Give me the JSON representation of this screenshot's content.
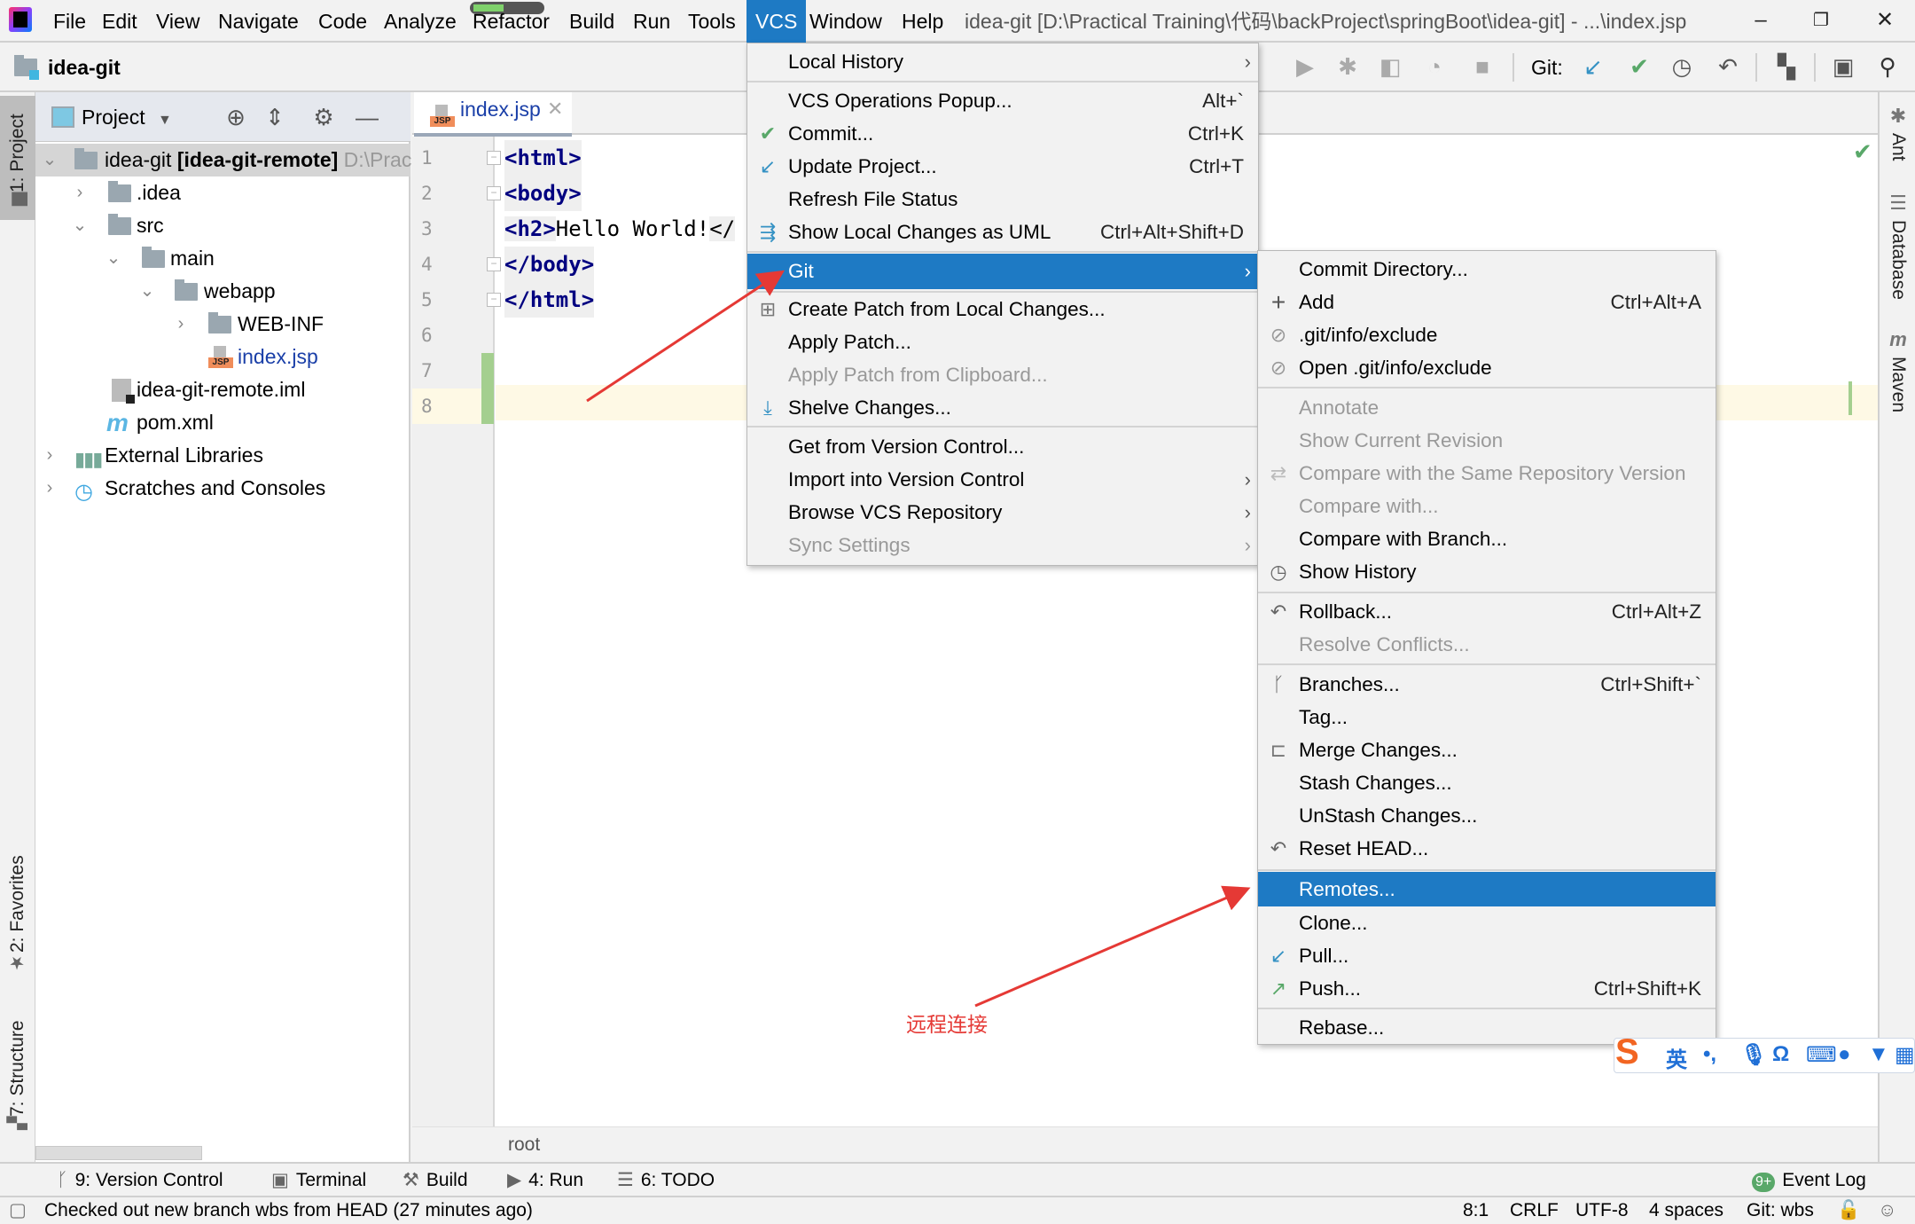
{
  "menubar": {
    "items": [
      "File",
      "Edit",
      "View",
      "Navigate",
      "Code",
      "Analyze",
      "Refactor",
      "Build",
      "Run",
      "Tools",
      "VCS",
      "Window",
      "Help"
    ],
    "active": "VCS",
    "window_title": "idea-git [D:\\Practical Training\\代码\\backProject\\springBoot\\idea-git] - ...\\index.jsp",
    "progress": 0.45,
    "controls": {
      "minimize": "–",
      "restore": "❐",
      "close": "✕"
    }
  },
  "navbar": {
    "project_name": "idea-git",
    "git_label": "Git:"
  },
  "left_stripe": {
    "tabs": [
      {
        "label": "1: Project",
        "icon": "folder-icon"
      },
      {
        "label": "2: Favorites",
        "icon": "star-icon"
      },
      {
        "label": "7: Structure",
        "icon": "structure-icon"
      }
    ]
  },
  "right_stripe": {
    "tabs": [
      {
        "label": "Ant",
        "icon": "ant-icon"
      },
      {
        "label": "Database",
        "icon": "database-icon"
      },
      {
        "label": "Maven",
        "icon": "maven-icon"
      }
    ]
  },
  "project_panel": {
    "title": "Project",
    "tree": [
      {
        "label": "idea-git",
        "bold_suffix": " [idea-git-remote]",
        "path_hint": " D:\\Prac",
        "expanded": true,
        "selected": true,
        "type": "module"
      },
      {
        "label": ".idea",
        "type": "folder",
        "expanded": false
      },
      {
        "label": "src",
        "type": "folder",
        "expanded": true
      },
      {
        "label": "main",
        "type": "folder",
        "expanded": true
      },
      {
        "label": "webapp",
        "type": "folder",
        "expanded": true
      },
      {
        "label": "WEB-INF",
        "type": "folder",
        "expanded": false
      },
      {
        "label": "index.jsp",
        "type": "jsp"
      },
      {
        "label": "idea-git-remote.iml",
        "type": "iml"
      },
      {
        "label": "pom.xml",
        "type": "maven"
      },
      {
        "label": "External Libraries",
        "type": "libraries",
        "expanded": false
      },
      {
        "label": "Scratches and Consoles",
        "type": "scratches",
        "expanded": false
      }
    ]
  },
  "editor": {
    "tab": "index.jsp",
    "tab_badge": "JSP",
    "line_numbers": [
      "1",
      "2",
      "3",
      "4",
      "5",
      "6",
      "7",
      "8"
    ],
    "lines": [
      {
        "tag": "<html>"
      },
      {
        "tag": "<body>"
      },
      {
        "open": "<h2>",
        "text": "Hello World!",
        "close": "</"
      },
      {
        "tag": "</body>"
      },
      {
        "tag": "</html>"
      },
      {
        "tag": ""
      },
      {
        "tag": ""
      },
      {
        "tag": ""
      }
    ],
    "breadcrumb": "root"
  },
  "vcs_menu": {
    "items": [
      {
        "label": "Local History",
        "submenu": true
      },
      {
        "sep": true
      },
      {
        "label": "VCS Operations Popup...",
        "shortcut": "Alt+`"
      },
      {
        "label": "Commit...",
        "shortcut": "Ctrl+K",
        "icon": "check"
      },
      {
        "label": "Update Project...",
        "shortcut": "Ctrl+T",
        "icon": "update"
      },
      {
        "label": "Refresh File Status"
      },
      {
        "label": "Show Local Changes as UML",
        "shortcut": "Ctrl+Alt+Shift+D",
        "icon": "uml"
      },
      {
        "sep": true
      },
      {
        "label": "Git",
        "submenu": true,
        "highlighted": true
      },
      {
        "sep": true
      },
      {
        "label": "Create Patch from Local Changes...",
        "icon": "patch"
      },
      {
        "label": "Apply Patch..."
      },
      {
        "label": "Apply Patch from Clipboard...",
        "disabled": true
      },
      {
        "label": "Shelve Changes...",
        "icon": "shelve"
      },
      {
        "sep": true
      },
      {
        "label": "Get from Version Control..."
      },
      {
        "label": "Import into Version Control",
        "submenu": true
      },
      {
        "label": "Browse VCS Repository",
        "submenu": true
      },
      {
        "label": "Sync Settings",
        "submenu": true,
        "disabled": true
      }
    ]
  },
  "git_menu": {
    "items": [
      {
        "label": "Commit Directory..."
      },
      {
        "label": "Add",
        "shortcut": "Ctrl+Alt+A",
        "icon": "plus"
      },
      {
        "label": ".git/info/exclude",
        "icon": "exclude"
      },
      {
        "label": "Open .git/info/exclude",
        "icon": "exclude"
      },
      {
        "sep": true
      },
      {
        "label": "Annotate",
        "disabled": true
      },
      {
        "label": "Show Current Revision",
        "disabled": true
      },
      {
        "label": "Compare with the Same Repository Version",
        "disabled": true,
        "icon": "compare"
      },
      {
        "label": "Compare with...",
        "disabled": true
      },
      {
        "label": "Compare with Branch..."
      },
      {
        "label": "Show History",
        "icon": "clock"
      },
      {
        "sep": true
      },
      {
        "label": "Rollback...",
        "shortcut": "Ctrl+Alt+Z",
        "icon": "undo"
      },
      {
        "label": "Resolve Conflicts...",
        "disabled": true
      },
      {
        "sep": true
      },
      {
        "label": "Branches...",
        "shortcut": "Ctrl+Shift+`",
        "icon": "branch"
      },
      {
        "label": "Tag..."
      },
      {
        "label": "Merge Changes...",
        "icon": "merge"
      },
      {
        "label": "Stash Changes..."
      },
      {
        "label": "UnStash Changes..."
      },
      {
        "label": "Reset HEAD...",
        "icon": "undo"
      },
      {
        "sep": true
      },
      {
        "label": "Remotes...",
        "highlighted": true
      },
      {
        "label": "Clone..."
      },
      {
        "label": "Pull...",
        "icon": "pull"
      },
      {
        "label": "Push...",
        "shortcut": "Ctrl+Shift+K",
        "icon": "push"
      },
      {
        "sep": true
      },
      {
        "label": "Rebase..."
      }
    ]
  },
  "annotation": {
    "text": "远程连接",
    "color": "#e53935"
  },
  "bottom_tools": [
    {
      "label": "9: Version Control",
      "icon": "vcs"
    },
    {
      "label": "Terminal",
      "icon": "terminal"
    },
    {
      "label": "Build",
      "icon": "hammer"
    },
    {
      "label": "4: Run",
      "icon": "run"
    },
    {
      "label": "6: TODO",
      "icon": "todo"
    }
  ],
  "event_log": {
    "label": "Event Log",
    "badge": "9+"
  },
  "statusbar": {
    "message": "Checked out new branch wbs from HEAD (27 minutes ago)",
    "position": "8:1",
    "line_sep": "CRLF",
    "encoding": "UTF-8",
    "indent": "4 spaces",
    "branch": "Git: wbs"
  },
  "ime": {
    "lang": "英",
    "punct": "•,"
  },
  "colors": {
    "accent": "#1e7ac4",
    "annotation": "#e53935",
    "added": "#a4cf8f"
  }
}
